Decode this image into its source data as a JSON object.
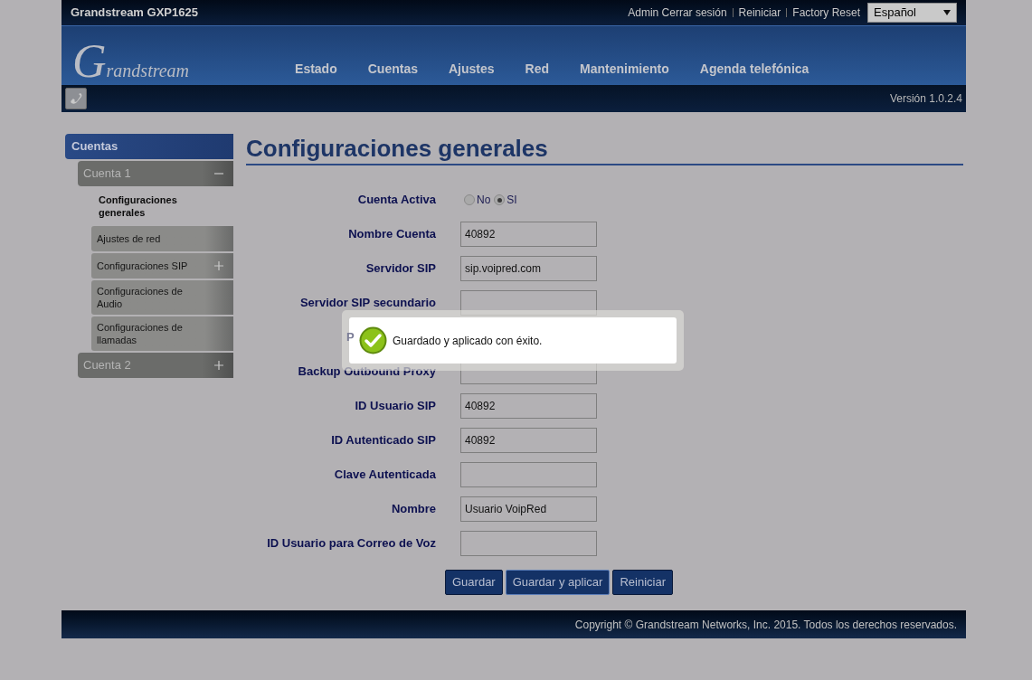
{
  "header": {
    "product": "Grandstream GXP1625",
    "links": [
      "Admin Cerrar sesión",
      "Reiniciar",
      "Factory Reset"
    ],
    "language": "Español",
    "logo": "Grandstream",
    "nav": [
      "Estado",
      "Cuentas",
      "Ajustes",
      "Red",
      "Mantenimiento",
      "Agenda telefónica"
    ],
    "version": "Versión 1.0.2.4"
  },
  "sidebar": {
    "title": "Cuentas",
    "items": [
      {
        "label": "Cuenta 1",
        "expanded": true,
        "children": [
          {
            "label": "Configuraciones generales",
            "selected": true
          },
          {
            "label": "Ajustes de red",
            "selected": false
          },
          {
            "label": "Configuraciones SIP",
            "selected": false,
            "expanded": false
          },
          {
            "label": "Configuraciones de Audio",
            "selected": false
          },
          {
            "label": "Configuraciones de llamadas",
            "selected": false
          }
        ]
      },
      {
        "label": "Cuenta 2",
        "expanded": false
      }
    ]
  },
  "page_title": "Configuraciones generales",
  "form": [
    {
      "kind": "radio",
      "label": "Cuenta Activa",
      "options": [
        {
          "label": "No",
          "selected": false
        },
        {
          "label": "SI",
          "selected": true
        }
      ]
    },
    {
      "kind": "text",
      "label": "Nombre Cuenta",
      "value": "40892"
    },
    {
      "kind": "text",
      "label": "Servidor SIP",
      "value": "sip.voipred.com"
    },
    {
      "kind": "text",
      "label": "Servidor SIP secundario"
    },
    {
      "kind": "covered",
      "label": "P"
    },
    {
      "kind": "text",
      "label": "Backup Outbound Proxy"
    },
    {
      "kind": "text",
      "label": "ID Usuario SIP",
      "value": "40892"
    },
    {
      "kind": "text",
      "label": "ID Autenticado SIP",
      "value": "40892"
    },
    {
      "kind": "text",
      "label": "Clave Autenticada"
    },
    {
      "kind": "text",
      "label": "Nombre",
      "value": "Usuario VoipRed"
    },
    {
      "kind": "text",
      "label": "ID Usuario para Correo de Voz"
    }
  ],
  "buttons": [
    {
      "label": "Guardar",
      "focused": false
    },
    {
      "label": "Guardar y aplicar",
      "focused": true
    },
    {
      "label": "Reiniciar",
      "focused": false
    }
  ],
  "toast": {
    "message": "Guardado y aplicado con éxito."
  },
  "footer": "Copyright © Grandstream Networks, Inc. 2015. Todos los derechos reservados."
}
